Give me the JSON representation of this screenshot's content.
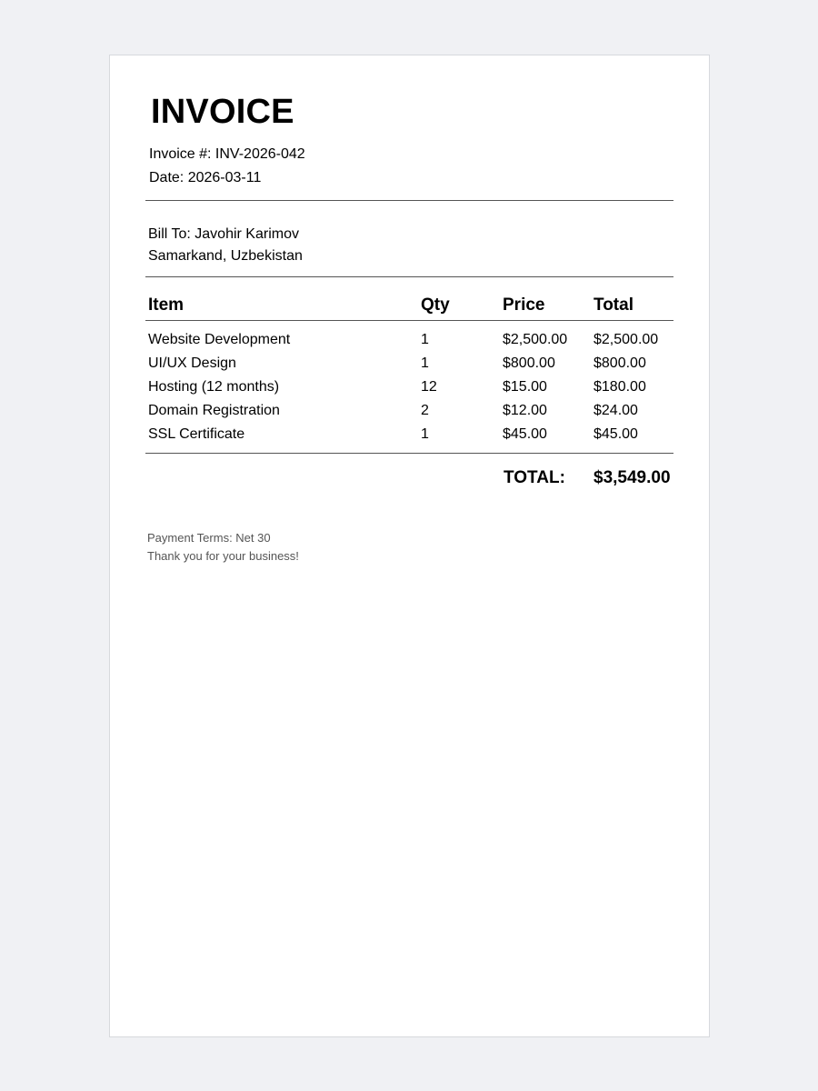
{
  "invoice": {
    "title": "INVOICE",
    "number_line": "Invoice #: INV-2026-042",
    "date_line": "Date: 2026-03-11"
  },
  "bill_to": {
    "line1": "Bill To: Javohir Karimov",
    "line2": "Samarkand, Uzbekistan"
  },
  "table": {
    "headers": [
      "Item",
      "Qty",
      "Price",
      "Total"
    ],
    "rows": [
      [
        "Website Development",
        "1",
        "$2,500.00",
        "$2,500.00"
      ],
      [
        "UI/UX Design",
        "1",
        "$800.00",
        "$800.00"
      ],
      [
        "Hosting (12 months)",
        "12",
        "$15.00",
        "$180.00"
      ],
      [
        "Domain Registration",
        "2",
        "$12.00",
        "$24.00"
      ],
      [
        "SSL Certificate",
        "1",
        "$45.00",
        "$45.00"
      ]
    ]
  },
  "totals": {
    "label": "TOTAL:",
    "value": "$3,549.00"
  },
  "footer": {
    "terms": "Payment Terms: Net 30",
    "thanks": "Thank you for your business!"
  }
}
